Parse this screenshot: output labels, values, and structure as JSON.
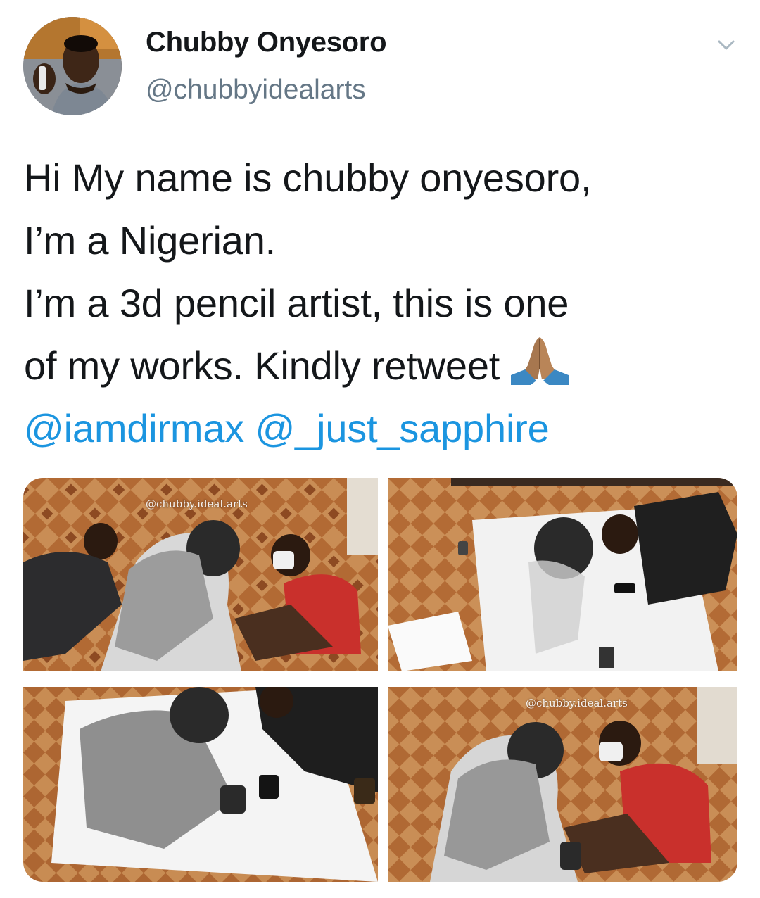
{
  "author": {
    "display_name": "Chubby Onyesoro",
    "handle": "@chubbyidealarts"
  },
  "tweet": {
    "lines": [
      "Hi My name is chubby onyesoro,",
      "I’m a Nigerian.",
      "I’m a 3d pencil artist, this is one",
      "of my works. Kindly retweet"
    ],
    "emoji": "folded-hands",
    "mentions": [
      "@iamdirmax",
      "@_just_sapphire"
    ]
  },
  "media": {
    "watermark": "@chubby.ideal.arts",
    "photos": [
      {
        "watermark": "@chubby.ideal.arts"
      },
      {
        "watermark": ""
      },
      {
        "watermark": ""
      },
      {
        "watermark": "@chubby.ideal.arts"
      }
    ]
  },
  "colors": {
    "mention": "#1b95e0",
    "handle": "#657786",
    "text": "#14171a"
  }
}
